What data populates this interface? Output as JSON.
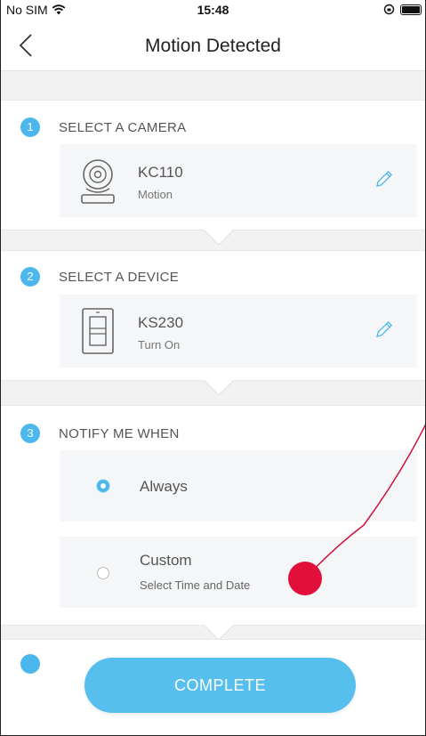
{
  "status_bar": {
    "carrier": "No SIM",
    "time": "15:48"
  },
  "nav": {
    "title": "Motion Detected",
    "back_icon": "chevron-left-icon"
  },
  "steps": [
    {
      "number": "1",
      "title": "SELECT A CAMERA",
      "device": {
        "name": "KC110",
        "subtitle": "Motion",
        "icon": "camera-icon"
      }
    },
    {
      "number": "2",
      "title": "SELECT A DEVICE",
      "device": {
        "name": "KS230",
        "subtitle": "Turn On",
        "icon": "switch-icon"
      }
    },
    {
      "number": "3",
      "title": "NOTIFY ME WHEN",
      "options": [
        {
          "label": "Always",
          "selected": true
        },
        {
          "label": "Custom",
          "subtitle": "Select Time and Date",
          "selected": false
        }
      ]
    }
  ],
  "complete_button": {
    "label": "COMPLETE"
  },
  "colors": {
    "accent": "#4cb7ec",
    "button": "#57bfee",
    "touch_marker": "#e0103a"
  }
}
